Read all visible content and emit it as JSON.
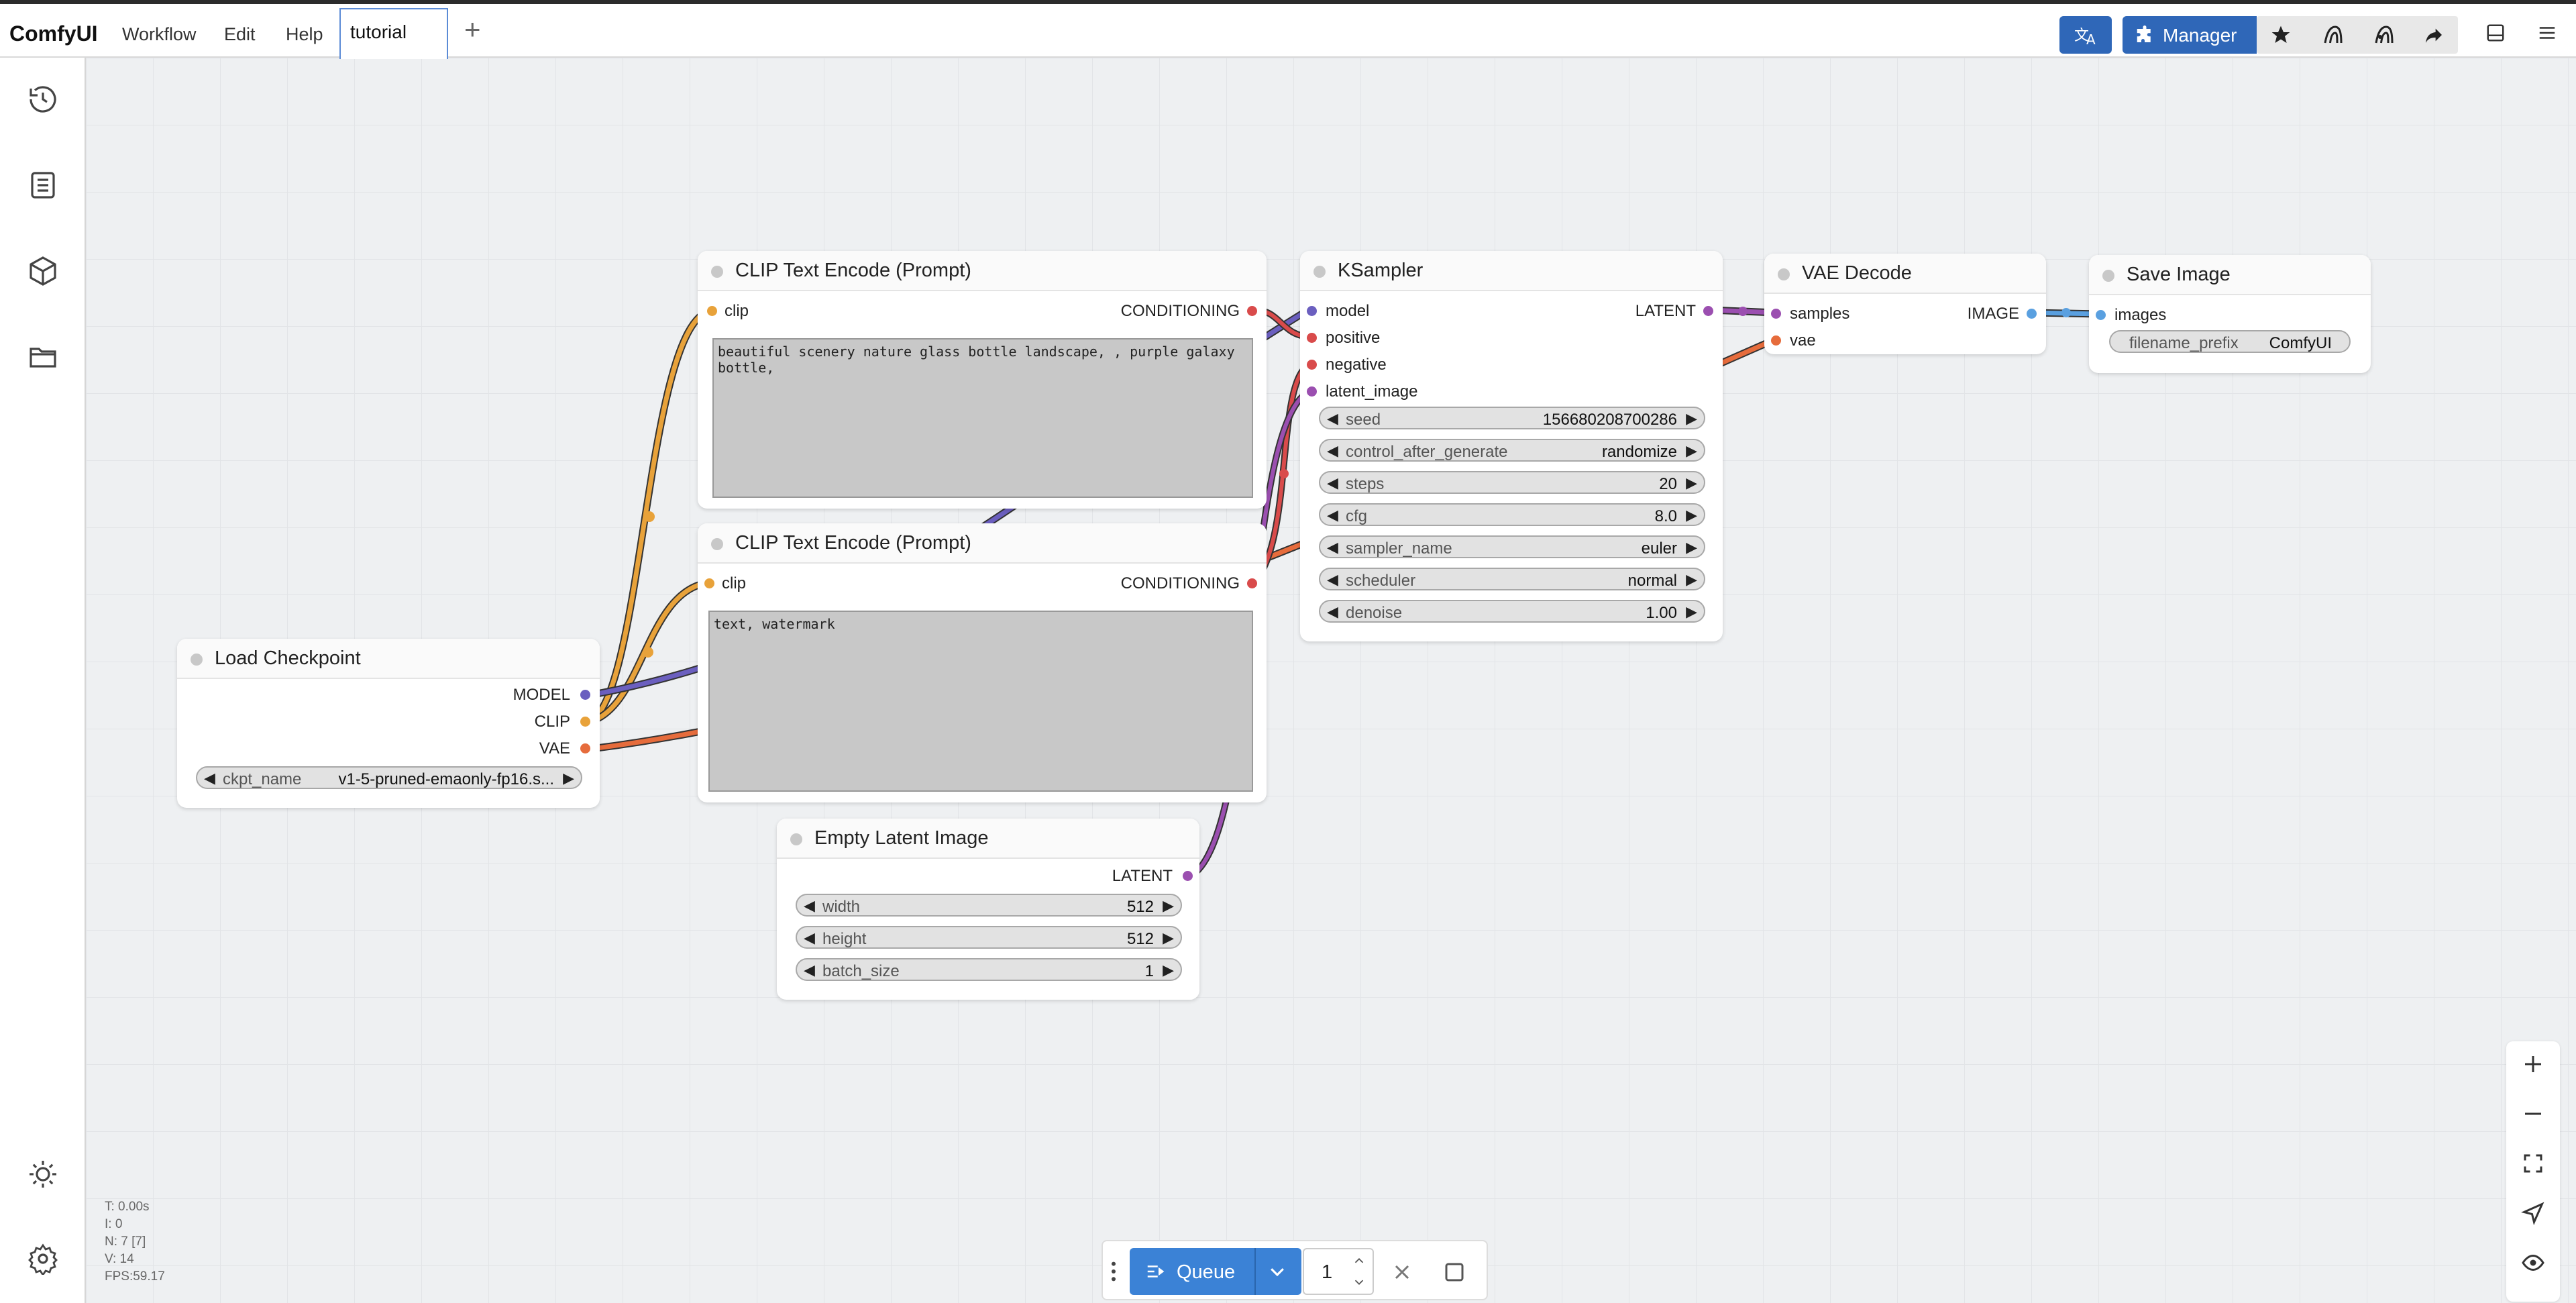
{
  "app": {
    "brand": "ComfyUI"
  },
  "menu": {
    "workflow": "Workflow",
    "edit": "Edit",
    "help": "Help"
  },
  "tabs": [
    {
      "label": "tutorial"
    }
  ],
  "topbar_right": {
    "manager_label": "Manager"
  },
  "nodes": {
    "clip_pos": {
      "title": "CLIP Text Encode (Prompt)",
      "input": "clip",
      "output": "CONDITIONING",
      "text": "beautiful scenery nature glass bottle landscape, , purple galaxy\nbottle,"
    },
    "clip_neg": {
      "title": "CLIP Text Encode (Prompt)",
      "input": "clip",
      "output": "CONDITIONING",
      "text": "text, watermark"
    },
    "ksampler": {
      "title": "KSampler",
      "inputs": [
        "model",
        "positive",
        "negative",
        "latent_image"
      ],
      "output": "LATENT",
      "widgets": [
        {
          "name": "seed",
          "value": "156680208700286"
        },
        {
          "name": "control_after_generate",
          "value": "randomize"
        },
        {
          "name": "steps",
          "value": "20"
        },
        {
          "name": "cfg",
          "value": "8.0"
        },
        {
          "name": "sampler_name",
          "value": "euler"
        },
        {
          "name": "scheduler",
          "value": "normal"
        },
        {
          "name": "denoise",
          "value": "1.00"
        }
      ]
    },
    "vae_decode": {
      "title": "VAE Decode",
      "inputs": [
        "samples",
        "vae"
      ],
      "output": "IMAGE"
    },
    "save_image": {
      "title": "Save Image",
      "input": "images",
      "widget": {
        "name": "filename_prefix",
        "value": "ComfyUI"
      }
    },
    "load_checkpoint": {
      "title": "Load Checkpoint",
      "outputs": [
        "MODEL",
        "CLIP",
        "VAE"
      ],
      "widget": {
        "name": "ckpt_name",
        "value": "v1-5-pruned-emaonly-fp16.s..."
      }
    },
    "empty_latent": {
      "title": "Empty Latent Image",
      "output": "LATENT",
      "widgets": [
        {
          "name": "width",
          "value": "512"
        },
        {
          "name": "height",
          "value": "512"
        },
        {
          "name": "batch_size",
          "value": "1"
        }
      ]
    }
  },
  "stats": {
    "t": "T: 0.00s",
    "i": "I: 0",
    "n": "N: 7 [7]",
    "v": "V: 14",
    "fps": "FPS:59.17"
  },
  "queue": {
    "label": "Queue",
    "count": "1"
  },
  "colors": {
    "accent": "#2f67b8",
    "queue_blue": "#3b82d6",
    "port_clip": "#e8a23a",
    "port_conditioning": "#d94b4b",
    "port_model": "#6b5fbf",
    "port_latent": "#9b4fb0",
    "port_vae": "#e66c3c",
    "port_image": "#5aa0e0",
    "canvas_bg": "#eef0f2"
  },
  "icons": {
    "sidebar": [
      "history-icon",
      "queue-list-icon",
      "model-library-icon",
      "workflows-folder-icon",
      "theme-toggle-icon",
      "settings-icon"
    ],
    "topbar": [
      "translate-icon",
      "puzzle-icon",
      "star-icon",
      "comfy-registry-icon",
      "comfy-registry-alt-icon",
      "share-icon",
      "bottom-panel-icon",
      "hamburger-menu-icon"
    ],
    "canvas_tools": [
      "zoom-in-icon",
      "zoom-out-icon",
      "fit-view-icon",
      "locate-icon",
      "eye-icon"
    ]
  }
}
